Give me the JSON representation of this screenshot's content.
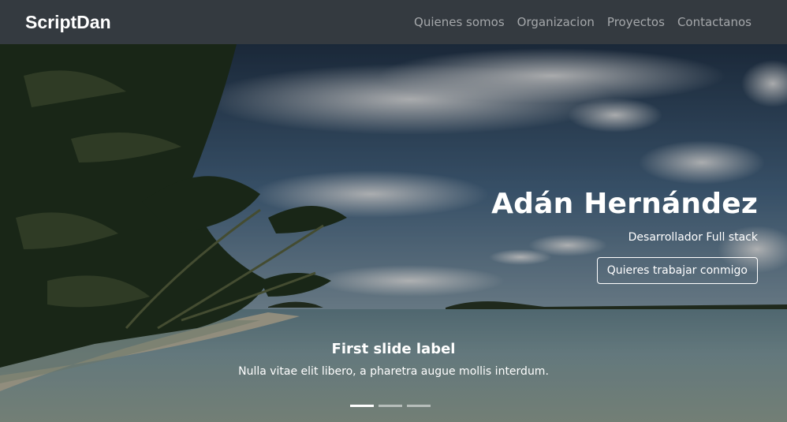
{
  "navbar": {
    "brand": "ScriptDan",
    "links": [
      "Quienes somos",
      "Organizacion",
      "Proyectos",
      "Contactanos"
    ]
  },
  "hero": {
    "name": "Adán Hernández",
    "role": "Desarrollador Full stack",
    "cta_label": "Quieres trabajar conmigo"
  },
  "carousel": {
    "caption_title": "First slide label",
    "caption_text": "Nulla vitae elit libero, a pharetra augue mollis interdum.",
    "slides": 3,
    "active_index": 0
  },
  "colors": {
    "navbar_bg": "#343a40",
    "nav_link": "rgba(255,255,255,0.55)"
  }
}
